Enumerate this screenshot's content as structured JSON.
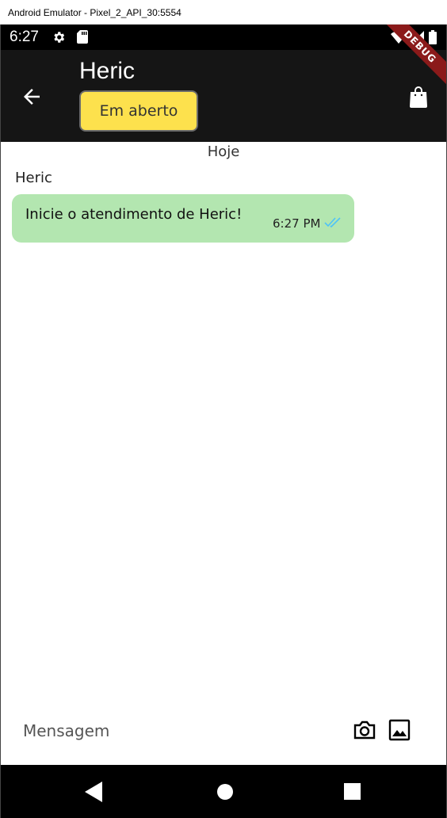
{
  "window": {
    "title": "Android Emulator - Pixel_2_API_30:5554"
  },
  "status_bar": {
    "time": "6:27",
    "debug_label": "DEBUG"
  },
  "app_bar": {
    "title": "Heric",
    "status_label": "Em aberto",
    "status_color": "#fde14d",
    "background": "#151515"
  },
  "chat": {
    "date_label": "Hoje",
    "sender": "Heric",
    "messages": [
      {
        "text": "Inicie o atendimento de Heric!",
        "time": "6:27 PM",
        "status": "read",
        "bubble_color": "#b3e6b0",
        "check_color": "#4fc3f7"
      }
    ]
  },
  "input": {
    "placeholder": "Mensagem",
    "value": ""
  },
  "icons": {
    "status": [
      "settings-icon",
      "sd-card-icon",
      "wifi-icon",
      "signal-icon",
      "battery-icon"
    ],
    "app_bar": [
      "arrow-back-icon",
      "shopping-bag-icon"
    ],
    "input": [
      "camera-icon",
      "image-icon"
    ],
    "nav": [
      "nav-back-icon",
      "nav-home-icon",
      "nav-recents-icon"
    ]
  }
}
